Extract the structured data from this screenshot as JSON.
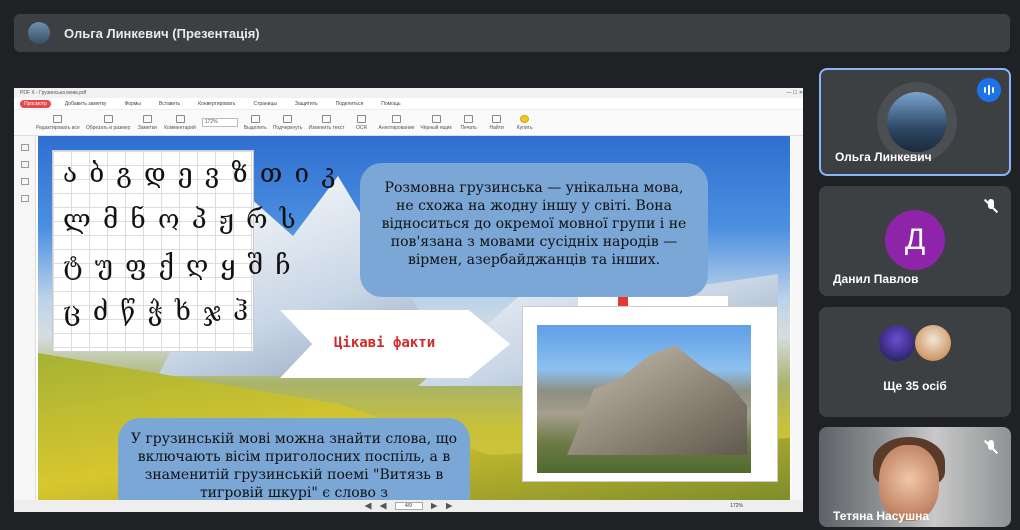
{
  "meeting": {
    "presenter_label": "Ольга Линкевич (Презентація)"
  },
  "pdf_app": {
    "title": "PDF X - Грузинська мова.pdf",
    "menu": [
      "Просмотр",
      "Добавить заметку",
      "Формы",
      "Вставить",
      "Конвертировать",
      "Страницы",
      "Защитить",
      "Поделиться",
      "Помощь"
    ],
    "toolbar": [
      "Редактировать все",
      "Обрезать и размер",
      "Заметки",
      "Комментарий",
      "Выделить",
      "Подчеркнуть",
      "Изменить текст",
      "OCR",
      "Аннотирование",
      "Чёрный ящик",
      "Печать",
      "Найти",
      "Купить"
    ],
    "zoom_value": "172%",
    "page_indicator": "4/9",
    "status_zoom": "172%"
  },
  "slide": {
    "alphabet_rows": [
      "ა ბ გ დ ე ვ ზ თ ი კ",
      "ლ მ ნ ო პ ჟ რ ს",
      "ტ უ ფ ქ ღ ყ შ ჩ",
      "ც ძ წ ჭ ხ ჯ ჰ"
    ],
    "top_text": "Розмовна грузинська — унікальна мова, не схожа на жодну іншу у світі. Вона відноситься до окремої мовної групи і не пов'язана з мовами сусідніх народів — вірмен, азербайджанців та інших.",
    "arrow_text": "Цікаві факти",
    "bottom_text": "У грузинській мові можна знайти слова, що включають вісім приголосних поспіль, а в знаменитій грузинській поемі \"Витязь в тигровій шкурі\" є слово з"
  },
  "participants": [
    {
      "name": "Ольга Линкевич",
      "speaking": true
    },
    {
      "name": "Данил Павлов",
      "initial": "Д",
      "muted": true
    },
    {
      "label": "Ще 35 осіб"
    },
    {
      "name": "Тетяна Насушна",
      "muted": true
    }
  ]
}
